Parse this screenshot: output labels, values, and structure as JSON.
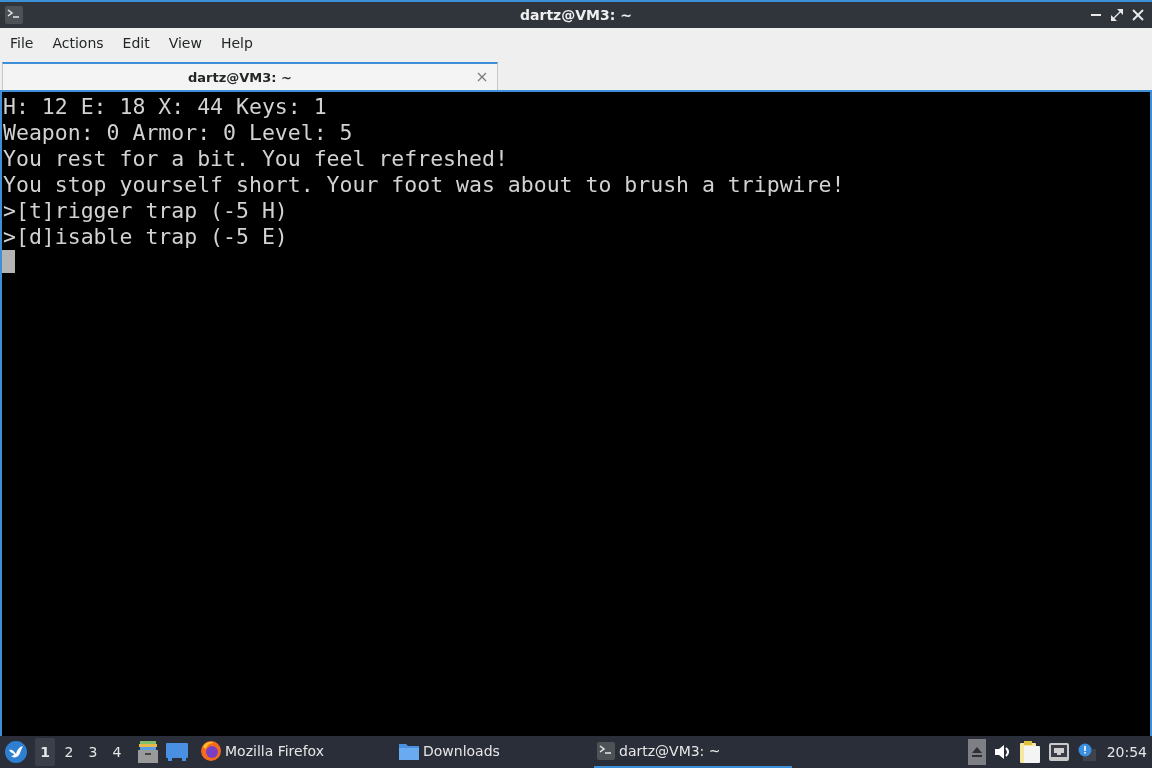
{
  "window": {
    "title": "dartz@VM3: ~"
  },
  "menu": [
    "File",
    "Actions",
    "Edit",
    "View",
    "Help"
  ],
  "tabs": [
    {
      "label": "dartz@VM3: ~",
      "selected": true
    }
  ],
  "terminal": {
    "lines": [
      "H: 12 E: 18 X: 44 Keys: 1",
      "Weapon: 0 Armor: 0 Level: 5",
      "You rest for a bit. You feel refreshed!",
      "You stop yourself short. Your foot was about to brush a tripwire!",
      ">[t]rigger trap (-5 H)",
      ">[d]isable trap (-5 E)"
    ],
    "cursor_visible": true
  },
  "taskbar": {
    "workspaces": [
      {
        "label": "1",
        "selected": true
      },
      {
        "label": "2",
        "selected": false
      },
      {
        "label": "3",
        "selected": false
      },
      {
        "label": "4",
        "selected": false
      }
    ],
    "tasks": [
      {
        "kind": "browser",
        "label": "Mozilla Firefox",
        "selected": false
      },
      {
        "kind": "folder",
        "label": "Downloads",
        "selected": false
      },
      {
        "kind": "terminal",
        "label": "dartz@VM3: ~",
        "selected": true
      }
    ],
    "clock": "20:54"
  }
}
